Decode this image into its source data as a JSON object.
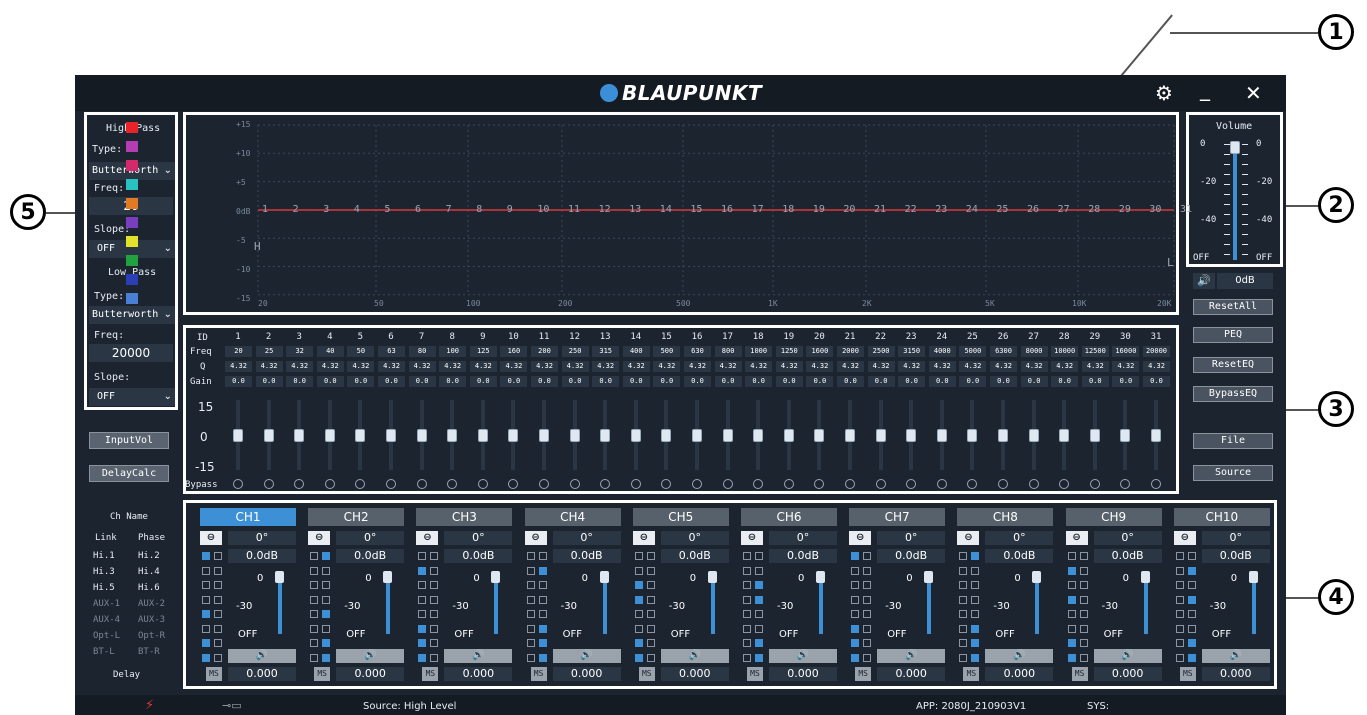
{
  "callouts": [
    "1",
    "2",
    "3",
    "4",
    "5"
  ],
  "header": {
    "brand": "BLAUPUNKT"
  },
  "titlebar_icons": [
    "settings-gear",
    "minimize",
    "close"
  ],
  "filters": {
    "high_pass": {
      "title": "High-Pass",
      "type_label": "Type:",
      "type": "Butterworth",
      "freq_label": "Freq:",
      "freq": "20",
      "slope_label": "Slope:",
      "slope": "OFF"
    },
    "low_pass": {
      "title": "Low_Pass",
      "type_label": "Type:",
      "type": "Butterworth",
      "freq_label": "Freq:",
      "freq": "20000",
      "slope_label": "Slope:",
      "slope": "OFF"
    }
  },
  "left_buttons": {
    "input_vol": "InputVol",
    "delay_calc": "DelayCalc"
  },
  "graph": {
    "y_ticks": [
      "+15",
      "+10",
      "+5",
      "0dB",
      "-5",
      "-10",
      "-15"
    ],
    "x_ticks": [
      "20",
      "50",
      "100",
      "200",
      "500",
      "1K",
      "2K",
      "5K",
      "10K",
      "20K"
    ],
    "h_marker": "H",
    "l_marker": "L",
    "swatch_colors": [
      "#e8232a",
      "#b43db3",
      "#d42a6d",
      "#29c1c1",
      "#e07a23",
      "#7a3fc0",
      "#e2e22a",
      "#1fa23f",
      "#2b3fb5",
      "#4a7fd6"
    ],
    "curve_color": "#d83a3a",
    "bands_on_curve": [
      "1",
      "2",
      "3",
      "4",
      "5",
      "6",
      "7",
      "8",
      "9",
      "10",
      "11",
      "12",
      "13",
      "14",
      "15",
      "16",
      "17",
      "18",
      "19",
      "20",
      "21",
      "22",
      "23",
      "24",
      "25",
      "26",
      "27",
      "28",
      "29",
      "30",
      "31"
    ]
  },
  "volume": {
    "title": "Volume",
    "scale_left": [
      "0",
      "-20",
      "-40",
      "OFF"
    ],
    "scale_right": [
      "0",
      "-20",
      "-40",
      "OFF"
    ],
    "level_db": "0dB",
    "level_fraction": 1.0
  },
  "right_buttons": {
    "reset_all": "ResetAll",
    "peq": "PEQ",
    "reset_eq": "ResetEQ",
    "bypass_eq": "BypassEQ",
    "file": "File",
    "source": "Source"
  },
  "eq": {
    "row_labels": {
      "id": "ID",
      "freq": "Freq",
      "q": "Q",
      "gain": "Gain",
      "bypass": "Bypass"
    },
    "scale": {
      "top": "15",
      "mid": "0",
      "bottom": "-15"
    },
    "bands": [
      {
        "id": "1",
        "freq": "20",
        "q": "4.32",
        "gain": "0.0"
      },
      {
        "id": "2",
        "freq": "25",
        "q": "4.32",
        "gain": "0.0"
      },
      {
        "id": "3",
        "freq": "32",
        "q": "4.32",
        "gain": "0.0"
      },
      {
        "id": "4",
        "freq": "40",
        "q": "4.32",
        "gain": "0.0"
      },
      {
        "id": "5",
        "freq": "50",
        "q": "4.32",
        "gain": "0.0"
      },
      {
        "id": "6",
        "freq": "63",
        "q": "4.32",
        "gain": "0.0"
      },
      {
        "id": "7",
        "freq": "80",
        "q": "4.32",
        "gain": "0.0"
      },
      {
        "id": "8",
        "freq": "100",
        "q": "4.32",
        "gain": "0.0"
      },
      {
        "id": "9",
        "freq": "125",
        "q": "4.32",
        "gain": "0.0"
      },
      {
        "id": "10",
        "freq": "160",
        "q": "4.32",
        "gain": "0.0"
      },
      {
        "id": "11",
        "freq": "200",
        "q": "4.32",
        "gain": "0.0"
      },
      {
        "id": "12",
        "freq": "250",
        "q": "4.32",
        "gain": "0.0"
      },
      {
        "id": "13",
        "freq": "315",
        "q": "4.32",
        "gain": "0.0"
      },
      {
        "id": "14",
        "freq": "400",
        "q": "4.32",
        "gain": "0.0"
      },
      {
        "id": "15",
        "freq": "500",
        "q": "4.32",
        "gain": "0.0"
      },
      {
        "id": "16",
        "freq": "630",
        "q": "4.32",
        "gain": "0.0"
      },
      {
        "id": "17",
        "freq": "800",
        "q": "4.32",
        "gain": "0.0"
      },
      {
        "id": "18",
        "freq": "1000",
        "q": "4.32",
        "gain": "0.0"
      },
      {
        "id": "19",
        "freq": "1250",
        "q": "4.32",
        "gain": "0.0"
      },
      {
        "id": "20",
        "freq": "1600",
        "q": "4.32",
        "gain": "0.0"
      },
      {
        "id": "21",
        "freq": "2000",
        "q": "4.32",
        "gain": "0.0"
      },
      {
        "id": "22",
        "freq": "2500",
        "q": "4.32",
        "gain": "0.0"
      },
      {
        "id": "23",
        "freq": "3150",
        "q": "4.32",
        "gain": "0.0"
      },
      {
        "id": "24",
        "freq": "4000",
        "q": "4.32",
        "gain": "0.0"
      },
      {
        "id": "25",
        "freq": "5000",
        "q": "4.32",
        "gain": "0.0"
      },
      {
        "id": "26",
        "freq": "6300",
        "q": "4.32",
        "gain": "0.0"
      },
      {
        "id": "27",
        "freq": "8000",
        "q": "4.32",
        "gain": "0.0"
      },
      {
        "id": "28",
        "freq": "10000",
        "q": "4.32",
        "gain": "0.0"
      },
      {
        "id": "29",
        "freq": "12500",
        "q": "4.32",
        "gain": "0.0"
      },
      {
        "id": "30",
        "freq": "16000",
        "q": "4.32",
        "gain": "0.0"
      },
      {
        "id": "31",
        "freq": "20000",
        "q": "4.32",
        "gain": "0.0"
      }
    ]
  },
  "ch_names": {
    "title": "Ch Name",
    "headers": [
      "Link",
      "Phase"
    ],
    "rows": [
      [
        "Hi.1",
        "Hi.2"
      ],
      [
        "Hi.3",
        "Hi.4"
      ],
      [
        "Hi.5",
        "Hi.6"
      ],
      [
        "AUX-1",
        "AUX-2"
      ],
      [
        "AUX-4",
        "AUX-3"
      ],
      [
        "Opt-L",
        "Opt-R"
      ],
      [
        "BT-L",
        "BT-R"
      ]
    ],
    "delay": "Delay"
  },
  "channels": [
    {
      "name": "CH1",
      "active": true,
      "phase": "0°",
      "gain": "0.0dB",
      "delay": "0.000",
      "checks": [
        [
          1,
          0
        ],
        [
          0,
          0
        ],
        [
          0,
          0
        ],
        [
          0,
          0
        ],
        [
          1,
          0
        ],
        [
          0,
          0
        ],
        [
          1,
          0
        ],
        [
          1,
          0
        ]
      ]
    },
    {
      "name": "CH2",
      "active": false,
      "phase": "0°",
      "gain": "0.0dB",
      "delay": "0.000",
      "checks": [
        [
          0,
          1
        ],
        [
          0,
          0
        ],
        [
          0,
          0
        ],
        [
          0,
          0
        ],
        [
          0,
          1
        ],
        [
          0,
          0
        ],
        [
          0,
          1
        ],
        [
          0,
          1
        ]
      ]
    },
    {
      "name": "CH3",
      "active": false,
      "phase": "0°",
      "gain": "0.0dB",
      "delay": "0.000",
      "checks": [
        [
          0,
          0
        ],
        [
          1,
          0
        ],
        [
          0,
          0
        ],
        [
          0,
          0
        ],
        [
          0,
          0
        ],
        [
          1,
          0
        ],
        [
          1,
          0
        ],
        [
          1,
          0
        ]
      ]
    },
    {
      "name": "CH4",
      "active": false,
      "phase": "0°",
      "gain": "0.0dB",
      "delay": "0.000",
      "checks": [
        [
          0,
          0
        ],
        [
          0,
          1
        ],
        [
          0,
          0
        ],
        [
          0,
          0
        ],
        [
          0,
          0
        ],
        [
          0,
          1
        ],
        [
          0,
          1
        ],
        [
          0,
          1
        ]
      ]
    },
    {
      "name": "CH5",
      "active": false,
      "phase": "0°",
      "gain": "0.0dB",
      "delay": "0.000",
      "checks": [
        [
          0,
          0
        ],
        [
          0,
          0
        ],
        [
          1,
          0
        ],
        [
          1,
          0
        ],
        [
          0,
          0
        ],
        [
          0,
          0
        ],
        [
          1,
          0
        ],
        [
          1,
          0
        ]
      ]
    },
    {
      "name": "CH6",
      "active": false,
      "phase": "0°",
      "gain": "0.0dB",
      "delay": "0.000",
      "checks": [
        [
          0,
          0
        ],
        [
          0,
          0
        ],
        [
          0,
          1
        ],
        [
          0,
          1
        ],
        [
          0,
          0
        ],
        [
          0,
          0
        ],
        [
          0,
          1
        ],
        [
          0,
          1
        ]
      ]
    },
    {
      "name": "CH7",
      "active": false,
      "phase": "0°",
      "gain": "0.0dB",
      "delay": "0.000",
      "checks": [
        [
          1,
          0
        ],
        [
          0,
          0
        ],
        [
          0,
          0
        ],
        [
          0,
          0
        ],
        [
          0,
          0
        ],
        [
          1,
          0
        ],
        [
          1,
          0
        ],
        [
          1,
          0
        ]
      ]
    },
    {
      "name": "CH8",
      "active": false,
      "phase": "0°",
      "gain": "0.0dB",
      "delay": "0.000",
      "checks": [
        [
          0,
          1
        ],
        [
          0,
          0
        ],
        [
          0,
          0
        ],
        [
          0,
          0
        ],
        [
          0,
          0
        ],
        [
          0,
          1
        ],
        [
          0,
          1
        ],
        [
          0,
          1
        ]
      ]
    },
    {
      "name": "CH9",
      "active": false,
      "phase": "0°",
      "gain": "0.0dB",
      "delay": "0.000",
      "checks": [
        [
          0,
          0
        ],
        [
          1,
          0
        ],
        [
          0,
          0
        ],
        [
          1,
          0
        ],
        [
          0,
          0
        ],
        [
          0,
          0
        ],
        [
          1,
          0
        ],
        [
          1,
          0
        ]
      ]
    },
    {
      "name": "CH10",
      "active": false,
      "phase": "0°",
      "gain": "0.0dB",
      "delay": "0.000",
      "checks": [
        [
          0,
          0
        ],
        [
          0,
          1
        ],
        [
          0,
          0
        ],
        [
          0,
          1
        ],
        [
          0,
          0
        ],
        [
          0,
          0
        ],
        [
          0,
          1
        ],
        [
          0,
          1
        ]
      ]
    }
  ],
  "channel_labels": {
    "fader_top": "0",
    "fader_mid": "-30",
    "fader_bottom": "OFF",
    "ms": "MS"
  },
  "status": {
    "source": "Source: High Level",
    "app": "APP: 2080J_210903V1",
    "sys": "SYS:"
  }
}
